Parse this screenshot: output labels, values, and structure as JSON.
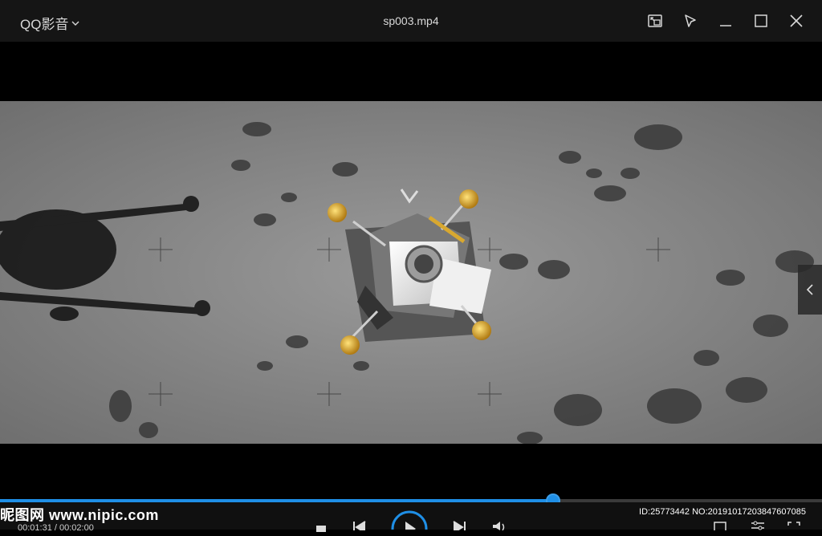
{
  "titlebar": {
    "app_name": "QQ影音",
    "file_name": "sp003.mp4",
    "icons": [
      "mini-mode-icon",
      "pin-icon",
      "minimize-icon",
      "maximize-icon",
      "close-icon"
    ]
  },
  "player": {
    "progress": 0.672,
    "time_display": "00:01:31 / 00:02:00",
    "controls": [
      "stop-icon",
      "previous-icon",
      "play-icon",
      "next-icon",
      "volume-icon",
      "screenshot-icon",
      "settings-icon",
      "fullscreen-icon"
    ]
  },
  "video": {
    "scene": "lunar-lander-descent"
  },
  "watermark": {
    "site": "昵图网 www.nipic.com",
    "id_text": "ID:25773442 NO:20191017203847607085"
  },
  "colors": {
    "accent": "#1f8fe6",
    "titlebar_bg": "#151515",
    "text": "#d8d8d8"
  }
}
